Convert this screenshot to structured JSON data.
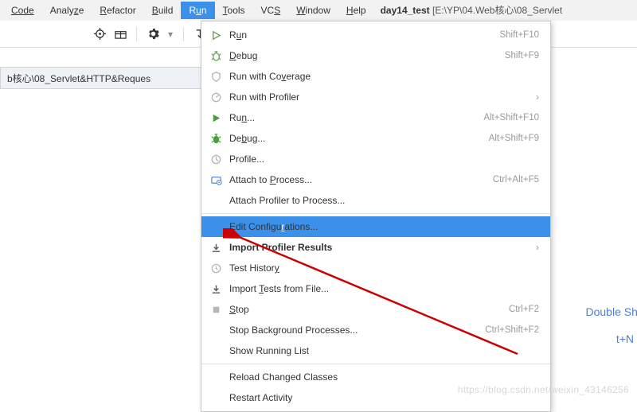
{
  "menubar": {
    "code": "Code",
    "analyze": "Analyze",
    "refactor": "Refactor",
    "build": "Build",
    "run": "Run",
    "tools": "Tools",
    "vcs": "VCS",
    "window": "Window",
    "help": "Help"
  },
  "project": {
    "name": "day14_test",
    "path": "[E:\\YP\\04.Web核心\\08_Servlet"
  },
  "breadcrumb": "b核心\\08_Servlet&HTTP&Reques",
  "dropdown": [
    {
      "icon": "play-outline",
      "label": "Run",
      "shortcut": "Shift+F10",
      "mn": "u"
    },
    {
      "icon": "bug",
      "label": "Debug",
      "shortcut": "Shift+F9",
      "mn": "D"
    },
    {
      "icon": "coverage",
      "label": "Run with Coverage",
      "disabled": true,
      "mn": "v"
    },
    {
      "icon": "profiler",
      "label": "Run with Profiler",
      "submenu": true,
      "disabled": true
    },
    {
      "icon": "play-solid",
      "label": "Run...",
      "shortcut": "Alt+Shift+F10",
      "mn": "n"
    },
    {
      "icon": "bug-solid",
      "label": "Debug...",
      "shortcut": "Alt+Shift+F9",
      "mn": "b"
    },
    {
      "icon": "profile",
      "label": "Profile...",
      "disabled": true
    },
    {
      "icon": "attach",
      "label": "Attach to Process...",
      "shortcut": "Ctrl+Alt+F5",
      "mn": "P"
    },
    {
      "label": "Attach Profiler to Process..."
    },
    {
      "sep": true
    },
    {
      "label": "Edit Configurations...",
      "selected": true,
      "mn": "r"
    },
    {
      "icon": "import",
      "label": "Import Profiler Results",
      "submenu": true,
      "bold": true
    },
    {
      "icon": "history",
      "label": "Test History",
      "disabled": true,
      "mn": "y"
    },
    {
      "icon": "import",
      "label": "Import Tests from File...",
      "mn": "T"
    },
    {
      "icon": "stop",
      "label": "Stop",
      "shortcut": "Ctrl+F2",
      "disabled": true,
      "mn": "S"
    },
    {
      "label": "Stop Background Processes...",
      "shortcut": "Ctrl+Shift+F2",
      "disabled": true
    },
    {
      "label": "Show Running List",
      "mn": "g"
    },
    {
      "sep": true
    },
    {
      "label": "Reload Changed Classes",
      "disabled": true
    },
    {
      "label": "Restart Activity",
      "disabled": true
    }
  ],
  "side_hints": {
    "h1": "Double Shi",
    "h2": "t+N"
  },
  "watermark": "https://blog.csdn.net/weixin_43146256"
}
